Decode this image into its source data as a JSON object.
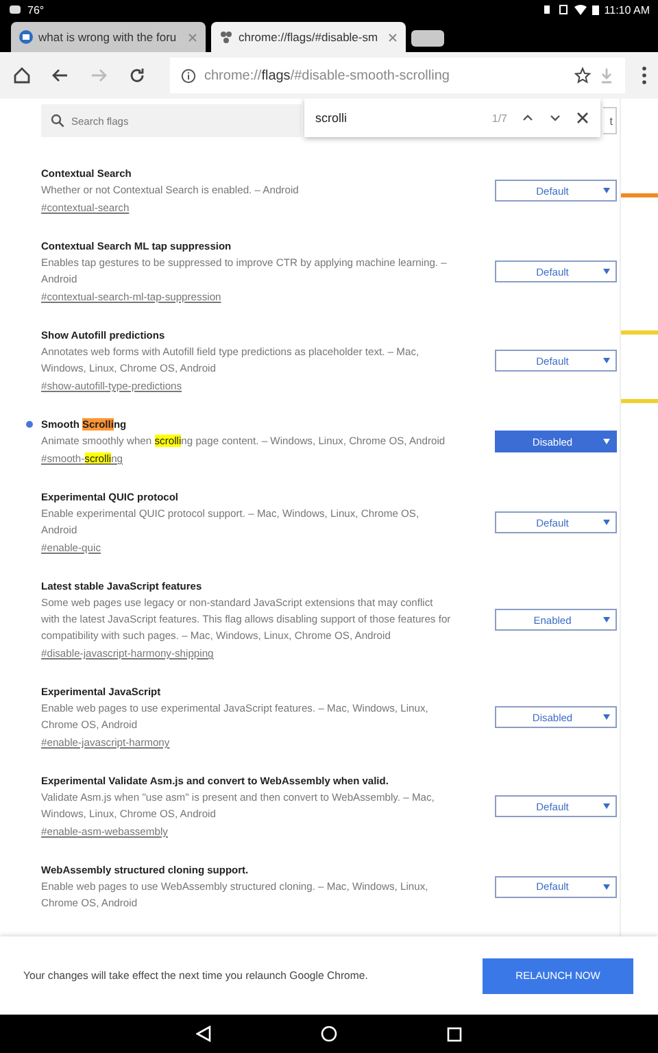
{
  "status_bar": {
    "temperature": "76°",
    "time": "11:10 AM"
  },
  "tabs": [
    {
      "title": "what is wrong with the foru",
      "selected": false
    },
    {
      "title": "chrome://flags/#disable-sm",
      "selected": true
    }
  ],
  "address_bar": {
    "scheme_host": "chrome://",
    "path_bold": "flags",
    "path_rest": "/#disable-smooth-scrolling"
  },
  "search": {
    "placeholder": "Search flags"
  },
  "reset_button": {
    "label": "t"
  },
  "find_bar": {
    "query": "scrolli",
    "count": "1/7"
  },
  "flags": [
    {
      "title": [
        {
          "text": "Contextual Search"
        }
      ],
      "description": [
        {
          "text": "Whether or not Contextual Search is enabled. – Android"
        }
      ],
      "link": [
        {
          "text": "#contextual-search"
        }
      ],
      "value": "Default",
      "modified": false
    },
    {
      "title": [
        {
          "text": "Contextual Search ML tap suppression"
        }
      ],
      "description": [
        {
          "text": "Enables tap gestures to be suppressed to improve CTR by applying machine learning. – Android"
        }
      ],
      "link": [
        {
          "text": "#contextual-search-ml-tap-suppression"
        }
      ],
      "value": "Default",
      "modified": false
    },
    {
      "title": [
        {
          "text": "Show Autofill predictions"
        }
      ],
      "description": [
        {
          "text": "Annotates web forms with Autofill field type predictions as placeholder text. – Mac, Windows, Linux, Chrome OS, Android"
        }
      ],
      "link": [
        {
          "text": "#show-autofill-type-predictions"
        }
      ],
      "value": "Default",
      "modified": false
    },
    {
      "title": [
        {
          "text": "Smooth "
        },
        {
          "text": "Scrolli",
          "highlighted": true,
          "current": true
        },
        {
          "text": "ng"
        }
      ],
      "description": [
        {
          "text": "Animate smoothly when "
        },
        {
          "text": "scrolli",
          "highlighted": true,
          "current": false
        },
        {
          "text": "ng page content. – Windows, Linux, Chrome OS, Android"
        }
      ],
      "link": [
        {
          "text": "#smooth-"
        },
        {
          "text": "scrolli",
          "highlighted": true,
          "current": false
        },
        {
          "text": "ng"
        }
      ],
      "value": "Disabled",
      "modified": true
    },
    {
      "title": [
        {
          "text": "Experimental QUIC protocol"
        }
      ],
      "description": [
        {
          "text": "Enable experimental QUIC protocol support. – Mac, Windows, Linux, Chrome OS, Android"
        }
      ],
      "link": [
        {
          "text": "#enable-quic"
        }
      ],
      "value": "Default",
      "modified": false
    },
    {
      "title": [
        {
          "text": "Latest stable JavaScript features"
        }
      ],
      "description": [
        {
          "text": "Some web pages use legacy or non-standard JavaScript extensions that may conflict with the latest JavaScript features. This flag allows disabling support of those features for compatibility with such pages. – Mac, Windows, Linux, Chrome OS, Android"
        }
      ],
      "link": [
        {
          "text": "#disable-javascript-harmony-shipping"
        }
      ],
      "value": "Enabled",
      "modified": false
    },
    {
      "title": [
        {
          "text": "Experimental JavaScript"
        }
      ],
      "description": [
        {
          "text": "Enable web pages to use experimental JavaScript features. – Mac, Windows, Linux, Chrome OS, Android"
        }
      ],
      "link": [
        {
          "text": "#enable-javascript-harmony"
        }
      ],
      "value": "Disabled",
      "modified": false
    },
    {
      "title": [
        {
          "text": "Experimental Validate Asm.js and convert to WebAssembly when valid."
        }
      ],
      "description": [
        {
          "text": "Validate Asm.js when \"use asm\" is present and then convert to WebAssembly. – Mac, Windows, Linux, Chrome OS, Android"
        }
      ],
      "link": [
        {
          "text": "#enable-asm-webassembly"
        }
      ],
      "value": "Default",
      "modified": false
    },
    {
      "title": [
        {
          "text": "WebAssembly structured cloning support."
        }
      ],
      "description": [
        {
          "text": "Enable web pages to use WebAssembly structured cloning. – Mac, Windows, Linux, Chrome OS, Android"
        }
      ],
      "value": "Default",
      "modified": false
    }
  ],
  "banner": {
    "message": "Your changes will take effect the next time you relaunch Google Chrome.",
    "button": "RELAUNCH NOW"
  }
}
